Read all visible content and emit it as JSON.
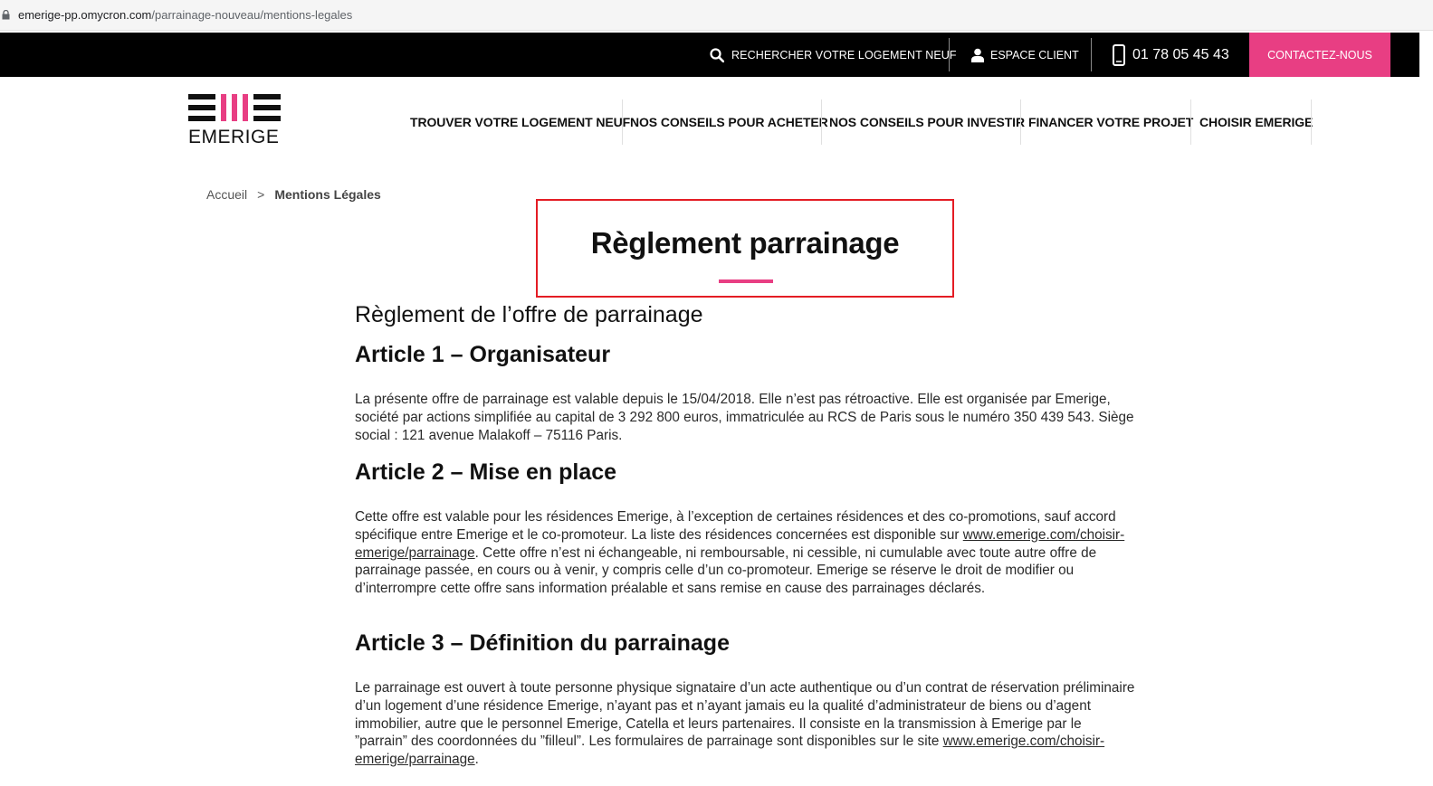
{
  "browser": {
    "url_domain": "emerige-pp.omycron.com",
    "url_path": "/parrainage-nouveau/mentions-legales"
  },
  "topbar": {
    "search_label": "RECHERCHER VOTRE LOGEMENT NEUF",
    "client_label": "ESPACE CLIENT",
    "phone": "01 78 05 45 43",
    "contact_label": "CONTACTEZ-NOUS",
    "contact_color": "#e83e83"
  },
  "logo": {
    "wordmark": "EMERIGE"
  },
  "nav": {
    "items": [
      {
        "label": "TROUVER VOTRE LOGEMENT NEUF"
      },
      {
        "label": "NOS CONSEILS POUR ACHETER"
      },
      {
        "label": "NOS CONSEILS POUR INVESTIR"
      },
      {
        "label": "FINANCER VOTRE PROJET"
      },
      {
        "label": "CHOISIR EMERIGE"
      }
    ]
  },
  "breadcrumb": {
    "home": "Accueil",
    "separator": ">",
    "current": "Mentions Légales"
  },
  "page": {
    "title": "Règlement parrainage",
    "subtitle": "Règlement de l’offre de parrainage",
    "articles": [
      {
        "heading": "Article 1 – Organisateur",
        "body": "La présente offre de parrainage est valable depuis le 15/04/2018. Elle n’est pas rétroactive. Elle est organisée par Emerige, société par actions simplifiée au capital de 3 292 800 euros, immatriculée au RCS de Paris sous le numéro 350 439 543. Siège social : 121 avenue Malakoff – 75116 Paris."
      },
      {
        "heading": "Article 2 – Mise en place",
        "body_before_link": "Cette offre est valable pour les résidences Emerige, à l’exception de certaines résidences et des co-promotions, sauf accord spécifique entre Emerige et le co-promoteur. La liste des résidences concernées est disponible sur ",
        "link": "www.emerige.com/choisir-emerige/parrainage",
        "body_after_link": ". Cette offre n’est ni échangeable, ni remboursable, ni cessible, ni cumulable avec toute autre offre de parrainage passée, en cours ou à venir, y compris celle d’un co-promoteur. Emerige se réserve le droit de modifier ou d’interrompre cette offre sans information préalable et sans remise en cause des parrainages déclarés."
      },
      {
        "heading": "Article 3 – Définition du parrainage",
        "body_before_link": "Le parrainage est ouvert à toute personne physique signataire d’un acte authentique ou d’un contrat de réservation préliminaire d’un logement d’une résidence Emerige, n’ayant pas et n’ayant jamais eu la qualité d’administrateur de biens ou d’agent immobilier, autre que le personnel Emerige, Catella et leurs partenaires. Il consiste en la transmission à Emerige par le ”parrain” des coordonnées du ”filleul”. Les formulaires de parrainage sont disponibles sur le site ",
        "link": "www.emerige.com/choisir-emerige/parrainage",
        "body_after_link": "."
      }
    ]
  },
  "colors": {
    "accent": "#e83e83",
    "highlight_border": "#e41c24",
    "topbar_bg": "#000000"
  }
}
